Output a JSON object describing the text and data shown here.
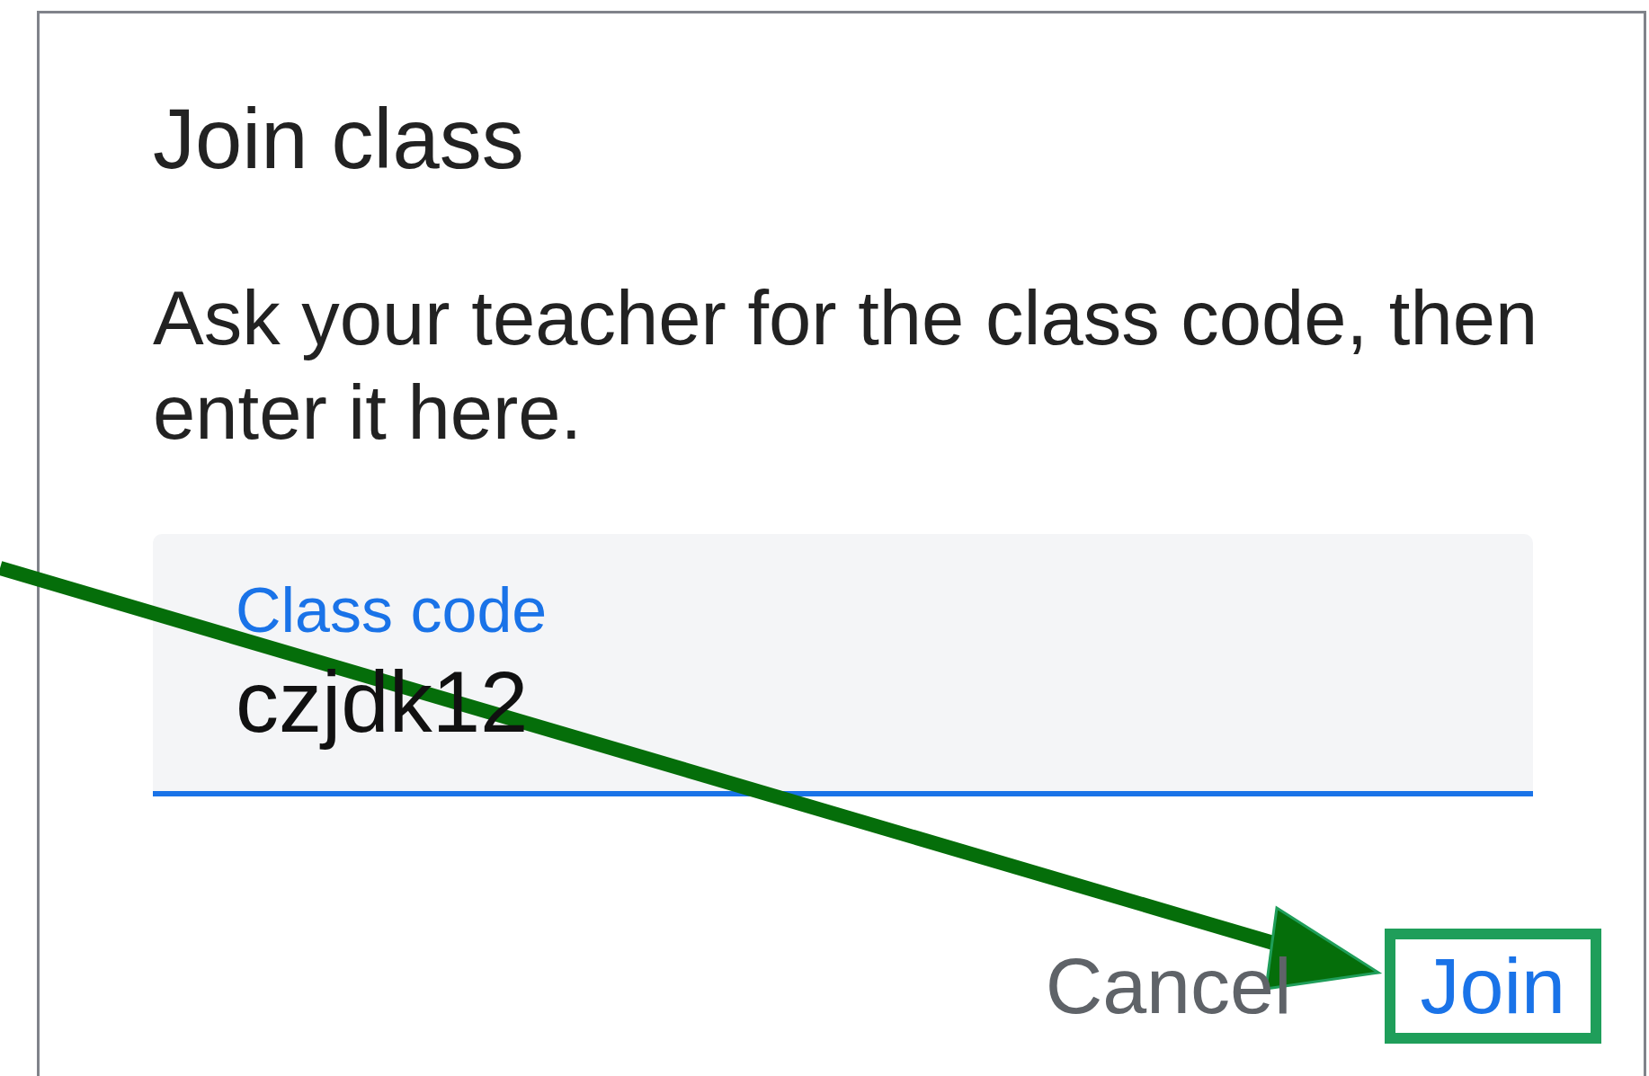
{
  "dialog": {
    "title": "Join class",
    "message": "Ask your teacher for the class code, then enter it here.",
    "field": {
      "label": "Class code",
      "value": "czjdk12",
      "focused": true
    },
    "buttons": [
      {
        "label": "Cancel",
        "kind": "secondary",
        "highlighted": false
      },
      {
        "label": "Join",
        "kind": "primary",
        "highlighted": true
      }
    ]
  }
}
